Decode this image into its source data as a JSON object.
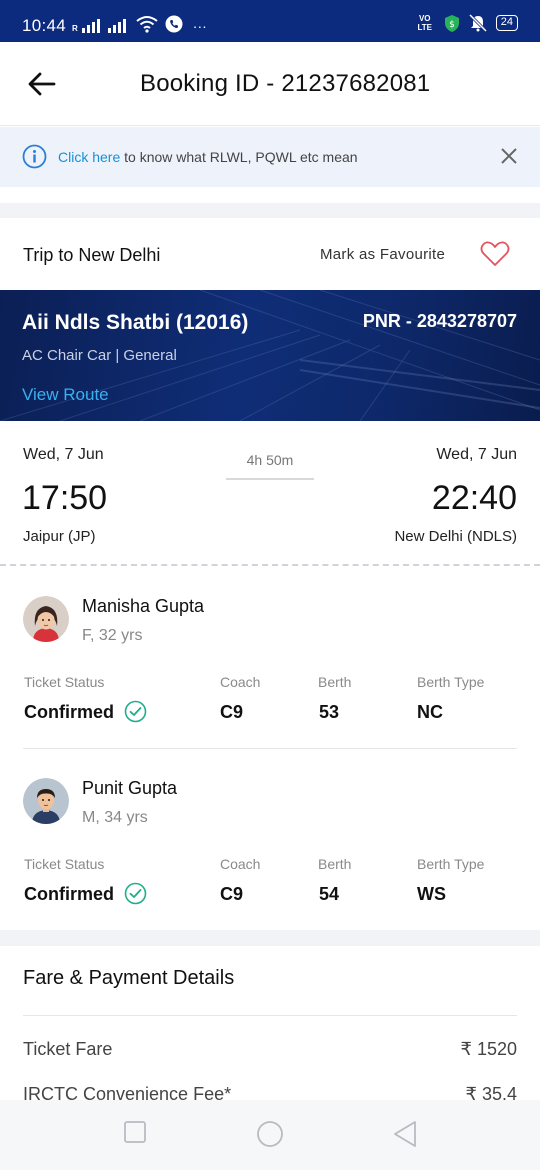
{
  "status_bar": {
    "time": "10:44",
    "carrier": "R",
    "volte": "VO LTE",
    "battery": "24"
  },
  "header": {
    "title": "Booking ID - 21237682081"
  },
  "info_banner": {
    "link_text": "Click here",
    "text": " to know what RLWL, PQWL etc mean"
  },
  "trip": {
    "title": "Trip to New Delhi",
    "favourite_label": "Mark as Favourite"
  },
  "train": {
    "name": "Aii Ndls Shatbi (12016)",
    "pnr": "PNR - 2843278707",
    "class_info": "AC Chair Car | General",
    "view_route": "View Route"
  },
  "journey": {
    "departure_date": "Wed, 7 Jun",
    "departure_time": "17:50",
    "departure_station": "Jaipur (JP)",
    "duration": "4h 50m",
    "arrival_date": "Wed, 7 Jun",
    "arrival_time": "22:40",
    "arrival_station": "New Delhi (NDLS)"
  },
  "labels": {
    "ticket_status": "Ticket Status",
    "coach": "Coach",
    "berth": "Berth",
    "berth_type": "Berth Type"
  },
  "passengers": [
    {
      "name": "Manisha Gupta",
      "meta": "F, 32 yrs",
      "status": "Confirmed",
      "coach": "C9",
      "berth": "53",
      "berth_type": "NC"
    },
    {
      "name": "Punit Gupta",
      "meta": "M, 34 yrs",
      "status": "Confirmed",
      "coach": "C9",
      "berth": "54",
      "berth_type": "WS"
    }
  ],
  "fare": {
    "title": "Fare & Payment Details",
    "rows": [
      {
        "label": "Ticket Fare",
        "value": "₹ 1520"
      },
      {
        "label": "IRCTC Convenience Fee*",
        "value": "₹ 35.4"
      }
    ]
  },
  "colors": {
    "status_bar": "#0d2b7e",
    "link": "#1a8fd8",
    "confirmed_check": "#1fae8b",
    "heart": "#e2545f"
  }
}
